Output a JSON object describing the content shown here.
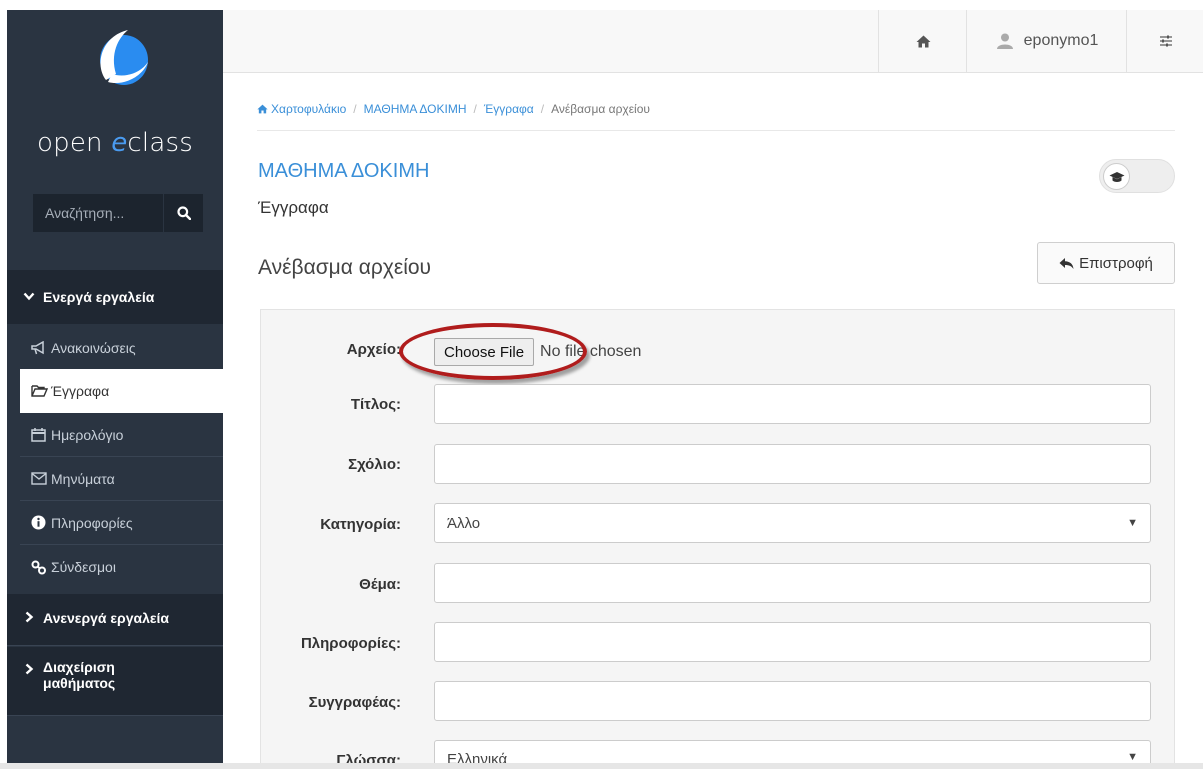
{
  "brand": {
    "logo_text_1": "open ",
    "logo_text_2": "e",
    "logo_text_3": "class"
  },
  "search": {
    "placeholder": "Αναζήτηση..."
  },
  "sidebar": {
    "active_group": "Ενεργά εργαλεία",
    "items": [
      {
        "label": "Ανακοινώσεις",
        "icon": "bullhorn-icon"
      },
      {
        "label": "Έγγραφα",
        "icon": "folder-open-icon"
      },
      {
        "label": "Ημερολόγιο",
        "icon": "calendar-icon"
      },
      {
        "label": "Μηνύματα",
        "icon": "envelope-icon"
      },
      {
        "label": "Πληροφορίες",
        "icon": "info-circle-icon"
      },
      {
        "label": "Σύνδεσμοι",
        "icon": "link-icon"
      }
    ],
    "inactive_group": "Ανενεργά εργαλεία",
    "admin_group_line1": "Διαχείριση",
    "admin_group_line2": "μαθήματος"
  },
  "topbar": {
    "username": "eponymo1"
  },
  "breadcrumb": [
    "Χαρτοφυλάκιο",
    "ΜΑΘΗΜΑ ΔΟΚΙΜΗ",
    "Έγγραφα",
    "Ανέβασμα αρχείου"
  ],
  "course": {
    "title": "ΜΑΘΗΜΑ ΔΟΚΙΜΗ",
    "section": "Έγγραφα"
  },
  "page": {
    "heading": "Ανέβασμα αρχείου",
    "back_label": "Επιστροφή"
  },
  "form": {
    "file_label": "Αρχείο:",
    "file_button": "Choose File",
    "file_status": "No file chosen",
    "title_label": "Τίτλος:",
    "comment_label": "Σχόλιο:",
    "category_label": "Κατηγορία:",
    "category_value": "Άλλο",
    "subject_label": "Θέμα:",
    "info_label": "Πληροφορίες:",
    "author_label": "Συγγραφέας:",
    "language_label": "Γλώσσα:",
    "language_value": "Ελληνικά"
  },
  "colors": {
    "sidebar": "#2a3441",
    "accent": "#3a8fd8",
    "highlight": "#b01c1c"
  }
}
